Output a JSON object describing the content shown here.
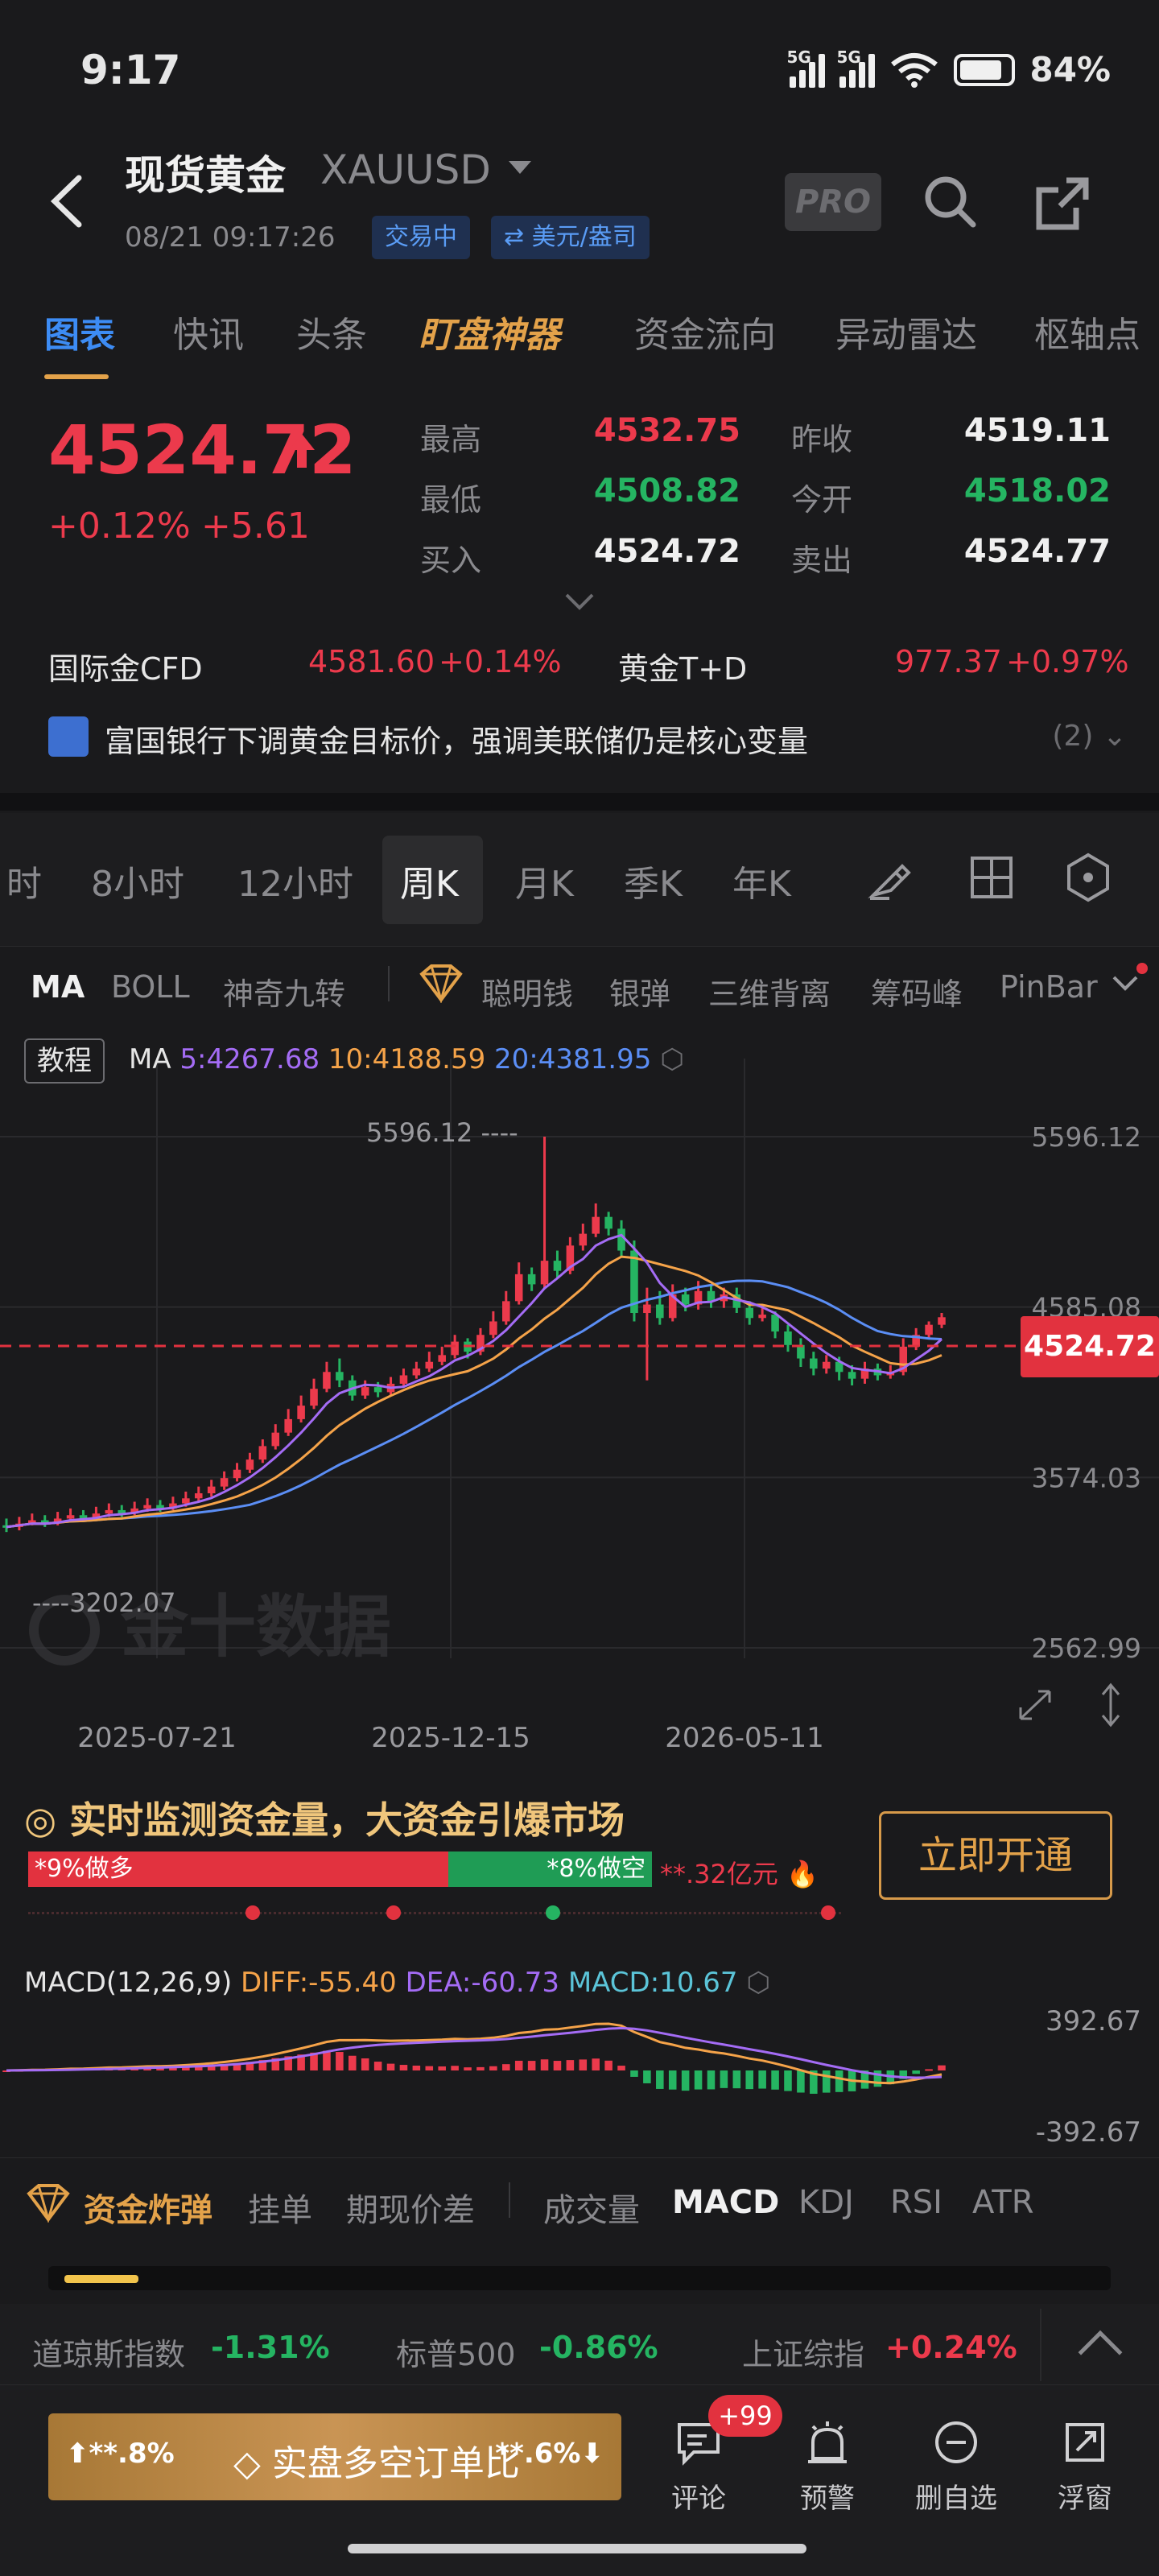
{
  "status_bar": {
    "time": "9:17",
    "net1": "5G",
    "net2": "5G",
    "battery": "84%"
  },
  "header": {
    "title": "现货黄金",
    "symbol": "XAUUSD",
    "datetime": "08/21 09:17:26",
    "status_chip": "交易中",
    "unit_chip": "⇄ 美元/盎司",
    "pro_label": "PRO"
  },
  "main_tabs": [
    "图表",
    "快讯",
    "头条",
    "盯盘神器",
    "资金流向",
    "异动雷达",
    "枢轴点"
  ],
  "quote": {
    "price": "4524.72",
    "change_pct": "+0.12%",
    "change_abs": "+5.61",
    "stats": [
      {
        "label": "最高",
        "value": "4532.75",
        "color": "red"
      },
      {
        "label": "最低",
        "value": "4508.82",
        "color": "green"
      },
      {
        "label": "买入",
        "value": "4524.72",
        "color": "white"
      },
      {
        "label": "昨收",
        "value": "4519.11",
        "color": "white"
      },
      {
        "label": "今开",
        "value": "4518.02",
        "color": "green"
      },
      {
        "label": "卖出",
        "value": "4524.77",
        "color": "white"
      }
    ]
  },
  "related": [
    {
      "name": "国际金CFD",
      "price": "4581.60",
      "change": "+0.14%"
    },
    {
      "name": "黄金T+D",
      "price": "977.37",
      "change": "+0.97%"
    }
  ],
  "news": {
    "text": "富国银行下调黄金目标价，强调美联储仍是核心变量",
    "count": "(2)"
  },
  "period_tabs": [
    "时",
    "8小时",
    "12小时",
    "周K",
    "月K",
    "季K",
    "年K"
  ],
  "active_period": "周K",
  "indicator_tabs": [
    "MA",
    "BOLL",
    "神奇九转",
    "聪明钱",
    "银弹",
    "三维背离",
    "筹码峰",
    "PinBar"
  ],
  "chart": {
    "tutorial": "教程",
    "ma_label": "MA",
    "ma5": "5:4267.68",
    "ma10": "10:4188.59",
    "ma20": "20:4381.95",
    "high_marker": "5596.12 ----",
    "low_marker": "----3202.07",
    "watermark": "金十数据",
    "price_tag": "4524.72",
    "colors": {
      "ma5": "#a46cf5",
      "ma10": "#f5a349",
      "ma20": "#5b8ef5",
      "up": "#ec3a4c",
      "down": "#25b462"
    }
  },
  "chart_data": {
    "type": "candlestick",
    "y_ticks": [
      "5596.12",
      "4585.08",
      "3574.03",
      "2562.99"
    ],
    "x_ticks": [
      "2025-07-21",
      "2025-12-15",
      "2026-05-11"
    ],
    "ylim": [
      2562.99,
      5596.12
    ],
    "current_price": 4524.72,
    "candles": [
      [
        3290,
        3280,
        3330,
        3250
      ],
      [
        3280,
        3300,
        3340,
        3260
      ],
      [
        3300,
        3320,
        3360,
        3290
      ],
      [
        3320,
        3300,
        3350,
        3280
      ],
      [
        3300,
        3330,
        3370,
        3290
      ],
      [
        3330,
        3350,
        3390,
        3310
      ],
      [
        3350,
        3330,
        3380,
        3310
      ],
      [
        3330,
        3360,
        3400,
        3320
      ],
      [
        3360,
        3380,
        3420,
        3340
      ],
      [
        3380,
        3360,
        3410,
        3340
      ],
      [
        3360,
        3390,
        3430,
        3350
      ],
      [
        3390,
        3410,
        3450,
        3370
      ],
      [
        3410,
        3390,
        3440,
        3370
      ],
      [
        3390,
        3420,
        3460,
        3380
      ],
      [
        3420,
        3450,
        3490,
        3400
      ],
      [
        3450,
        3480,
        3520,
        3430
      ],
      [
        3480,
        3520,
        3560,
        3460
      ],
      [
        3520,
        3570,
        3610,
        3500
      ],
      [
        3570,
        3620,
        3660,
        3550
      ],
      [
        3620,
        3680,
        3720,
        3600
      ],
      [
        3680,
        3760,
        3800,
        3660
      ],
      [
        3760,
        3840,
        3890,
        3740
      ],
      [
        3840,
        3920,
        3980,
        3820
      ],
      [
        3920,
        4000,
        4060,
        3900
      ],
      [
        4000,
        4100,
        4160,
        3980
      ],
      [
        4100,
        4200,
        4260,
        4080
      ],
      [
        4200,
        4150,
        4280,
        4110
      ],
      [
        4150,
        4060,
        4180,
        4030
      ],
      [
        4060,
        4110,
        4150,
        4040
      ],
      [
        4110,
        4080,
        4140,
        4050
      ],
      [
        4080,
        4130,
        4170,
        4060
      ],
      [
        4130,
        4180,
        4220,
        4110
      ],
      [
        4180,
        4220,
        4260,
        4160
      ],
      [
        4220,
        4260,
        4320,
        4200
      ],
      [
        4260,
        4300,
        4350,
        4240
      ],
      [
        4300,
        4380,
        4420,
        4280
      ],
      [
        4380,
        4320,
        4400,
        4280
      ],
      [
        4320,
        4420,
        4460,
        4300
      ],
      [
        4420,
        4500,
        4560,
        4400
      ],
      [
        4500,
        4620,
        4680,
        4480
      ],
      [
        4620,
        4780,
        4850,
        4600
      ],
      [
        4780,
        4720,
        4820,
        4680
      ],
      [
        4720,
        4860,
        5596.12,
        4700
      ],
      [
        4860,
        4800,
        4920,
        4760
      ],
      [
        4800,
        4950,
        5000,
        4780
      ],
      [
        4950,
        5020,
        5080,
        4920
      ],
      [
        5020,
        5120,
        5200,
        5000
      ],
      [
        5120,
        5050,
        5150,
        5010
      ],
      [
        5050,
        4920,
        5100,
        4880
      ],
      [
        4920,
        4550,
        4980,
        4500
      ],
      [
        4550,
        4600,
        4700,
        4150
      ],
      [
        4600,
        4520,
        4680,
        4480
      ],
      [
        4520,
        4660,
        4720,
        4500
      ],
      [
        4660,
        4600,
        4700,
        4560
      ],
      [
        4600,
        4680,
        4740,
        4570
      ],
      [
        4680,
        4620,
        4720,
        4580
      ],
      [
        4620,
        4660,
        4700,
        4580
      ],
      [
        4660,
        4580,
        4700,
        4550
      ],
      [
        4580,
        4520,
        4620,
        4480
      ],
      [
        4520,
        4540,
        4600,
        4500
      ],
      [
        4540,
        4440,
        4560,
        4400
      ],
      [
        4440,
        4360,
        4480,
        4320
      ],
      [
        4360,
        4280,
        4400,
        4230
      ],
      [
        4280,
        4220,
        4320,
        4180
      ],
      [
        4220,
        4260,
        4300,
        4190
      ],
      [
        4260,
        4200,
        4290,
        4150
      ],
      [
        4200,
        4160,
        4240,
        4120
      ],
      [
        4160,
        4220,
        4260,
        4130
      ],
      [
        4220,
        4180,
        4250,
        4150
      ],
      [
        4180,
        4200,
        4240,
        4160
      ],
      [
        4200,
        4350,
        4400,
        4180
      ],
      [
        4350,
        4420,
        4460,
        4330
      ],
      [
        4420,
        4480,
        4500,
        4400
      ],
      [
        4480,
        4524.72,
        4550,
        4460
      ]
    ],
    "series": [
      {
        "name": "MA5"
      },
      {
        "name": "MA10"
      },
      {
        "name": "MA20"
      }
    ]
  },
  "promo": {
    "title": "实时监测资金量，大资金引爆市场",
    "long_label": "*9%做多",
    "short_label": "*8%做空",
    "amount": "**.32亿元",
    "button": "立即开通"
  },
  "macd": {
    "label": "MACD(12,26,9)",
    "diff": "DIFF:-55.40",
    "dea": "DEA:-60.73",
    "macd": "MACD:10.67",
    "y_top": "392.67",
    "y_bottom": "-392.67"
  },
  "sub_tabs": [
    "资金炸弹",
    "挂单",
    "期现价差",
    "成交量",
    "MACD",
    "KDJ",
    "RSI",
    "ATR"
  ],
  "ticker": [
    {
      "name": "道琼斯指数",
      "change": "-1.31%",
      "dir": "down"
    },
    {
      "name": "标普500",
      "change": "-0.86%",
      "dir": "down"
    },
    {
      "name": "上证综指",
      "change": "+0.24%",
      "dir": "up"
    }
  ],
  "bottom_nav": {
    "ratio_long": "⬆**.8%",
    "ratio_label": "实盘多空订单比",
    "ratio_short": "**.6%⬇",
    "comment_badge": "+99",
    "items": [
      "评论",
      "预警",
      "删自选",
      "浮窗"
    ]
  }
}
